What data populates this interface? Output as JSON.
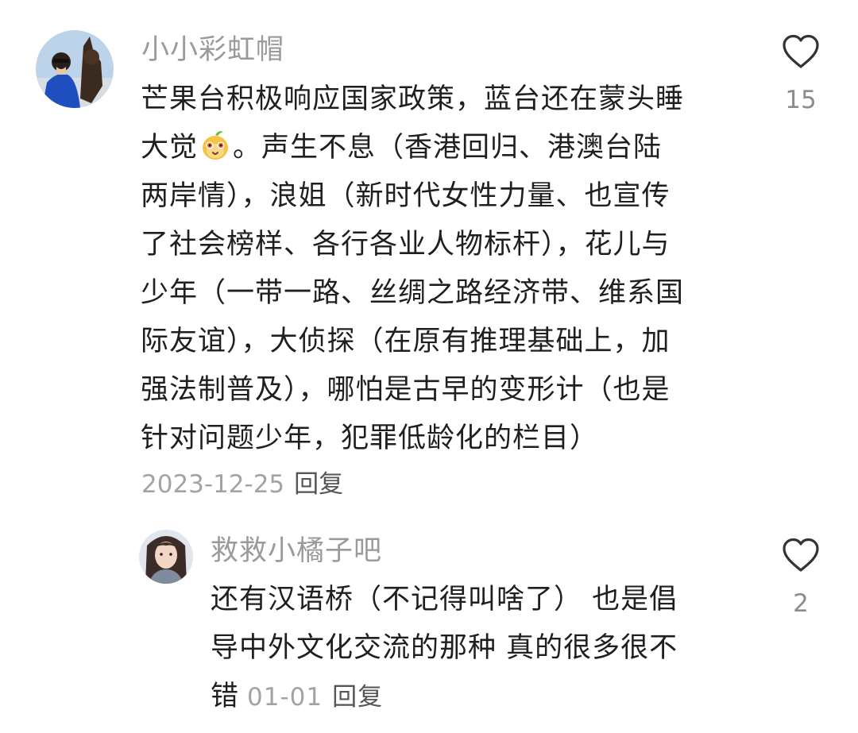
{
  "comment": {
    "username": "小小彩虹帽",
    "lines": [
      "芒果台积极响应国家政策，蓝台还在蒙头睡",
      "声生不息（香港回归、港澳台陆",
      "两岸情），浪姐（新时代女性力量、也宣传",
      "了社会榜样、各行各业人物标杆），花儿与",
      "少年（一带一路、丝绸之路经济带、维系国",
      "际友谊），大侦探（在原有推理基础上，加",
      "强法制普及），哪怕是古早的变形计（也是",
      "针对问题少年，犯罪低龄化的栏目）"
    ],
    "line2_prefix": "大觉",
    "line2_suffix": "。",
    "emoji": "mango-face-emoji",
    "date": "2023-12-25",
    "reply_label": "回复",
    "like_count": "15",
    "like_icon": "heart-outline-icon"
  },
  "reply": {
    "username": "救救小橘子吧",
    "lines": [
      "还有汉语桥（不记得叫啥了） 也是倡",
      "导中外文化交流的那种 真的很多很不",
      "错"
    ],
    "date": "01-01",
    "reply_label": "回复",
    "like_count": "2",
    "like_icon": "heart-outline-icon"
  },
  "colors": {
    "username": "#9a9a9a",
    "text": "#1f1f1f",
    "meta": "#a3a3a3",
    "reply": "#555555",
    "like_count": "#8c8c8c",
    "background": "#ffffff"
  }
}
